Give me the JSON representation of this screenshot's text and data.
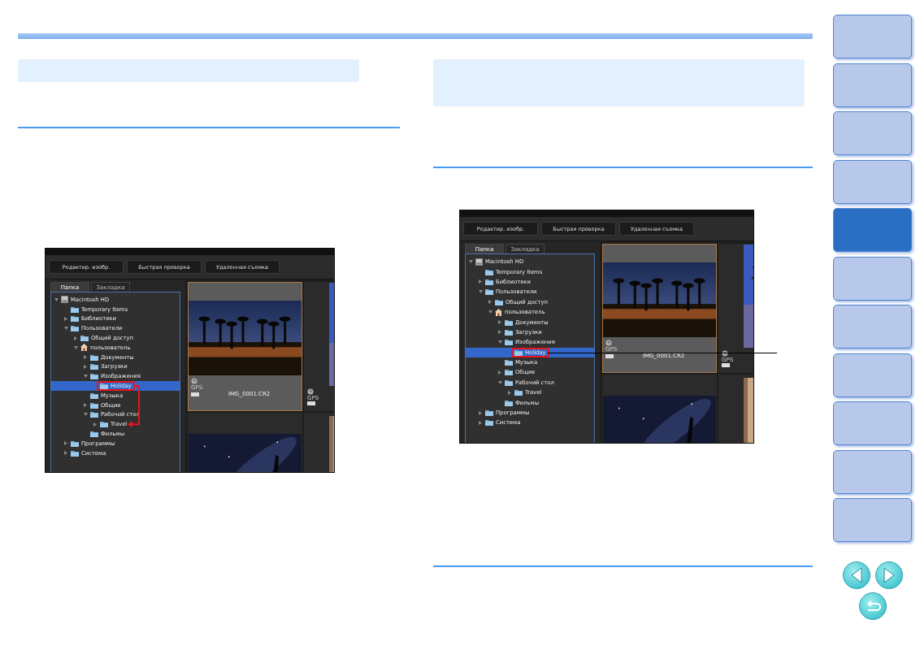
{
  "chapter_nav": [
    {
      "selected": false
    },
    {
      "selected": false
    },
    {
      "selected": false
    },
    {
      "selected": false
    },
    {
      "selected": true
    },
    {
      "selected": false
    },
    {
      "selected": false
    },
    {
      "selected": false
    },
    {
      "selected": false
    },
    {
      "selected": false
    },
    {
      "selected": false
    }
  ],
  "pager": [
    {
      "kind": "prev"
    },
    {
      "kind": "next"
    },
    {
      "kind": "return"
    }
  ],
  "screens": [
    {
      "kind": "arrow",
      "toolbar": [
        "Редактир. изобр.",
        "Быстрая проверка",
        "Удаленная съемка"
      ],
      "tabs": [
        {
          "label": "Папка",
          "selected": true
        },
        {
          "label": "Закладка",
          "selected": false
        }
      ],
      "tree": [
        {
          "label": "Macintosh HD",
          "kind": "disk",
          "expandable": true,
          "expanded": true,
          "selected": false,
          "children": [
            {
              "label": "Temporary Items",
              "kind": "folder",
              "expandable": false,
              "selected": false
            },
            {
              "label": "Библиотеки",
              "kind": "folder",
              "expandable": true,
              "expanded": false,
              "selected": false
            },
            {
              "label": "Пользователи",
              "kind": "folder",
              "expandable": true,
              "expanded": true,
              "selected": false,
              "children": [
                {
                  "label": "Общий доступ",
                  "kind": "folder",
                  "expandable": true,
                  "expanded": false,
                  "selected": false
                },
                {
                  "label": "пользователь",
                  "kind": "home",
                  "expandable": true,
                  "expanded": true,
                  "selected": false,
                  "children": [
                    {
                      "label": "Документы",
                      "kind": "folder",
                      "expandable": true,
                      "expanded": false,
                      "selected": false
                    },
                    {
                      "label": "Загрузки",
                      "kind": "folder",
                      "expandable": true,
                      "expanded": false,
                      "selected": false
                    },
                    {
                      "label": "Изображения",
                      "kind": "folder",
                      "expandable": true,
                      "expanded": true,
                      "selected": false,
                      "children": [
                        {
                          "label": "Holiday",
                          "kind": "folder",
                          "expandable": false,
                          "selected": true
                        }
                      ]
                    },
                    {
                      "label": "Музыка",
                      "kind": "folder",
                      "expandable": false,
                      "selected": false
                    },
                    {
                      "label": "Общие",
                      "kind": "folder",
                      "expandable": true,
                      "expanded": false,
                      "selected": false
                    },
                    {
                      "label": "Рабочий стол",
                      "kind": "folder",
                      "expandable": true,
                      "expanded": true,
                      "selected": false,
                      "children": [
                        {
                          "label": "Travel",
                          "kind": "folder",
                          "expandable": true,
                          "expanded": false,
                          "selected": false
                        }
                      ]
                    },
                    {
                      "label": "Фильмы",
                      "kind": "folder",
                      "expandable": false,
                      "selected": false
                    }
                  ]
                }
              ]
            },
            {
              "label": "Программы",
              "kind": "folder",
              "expandable": true,
              "expanded": false,
              "selected": false
            },
            {
              "label": "Система",
              "kind": "folder",
              "expandable": true,
              "expanded": false,
              "selected": false
            }
          ]
        }
      ],
      "thumbnails": [
        {
          "selected": true,
          "gps": "GPS",
          "filename": "IMG_0001.CR2"
        },
        {
          "selected": false,
          "gps": "GPS"
        },
        {
          "selected": false
        },
        {
          "selected": false
        }
      ]
    },
    {
      "kind": "leader",
      "toolbar": [
        "Редактир. изобр.",
        "Быстрая проверка",
        "Удаленная съемка"
      ],
      "tabs": [
        {
          "label": "Папка",
          "selected": true
        },
        {
          "label": "Закладка",
          "selected": false
        }
      ],
      "tree": [
        {
          "label": "Macintosh HD",
          "kind": "disk",
          "expandable": true,
          "expanded": true,
          "selected": false,
          "children": [
            {
              "label": "Temporary Items",
              "kind": "folder",
              "expandable": false,
              "selected": false
            },
            {
              "label": "Библиотеки",
              "kind": "folder",
              "expandable": true,
              "expanded": false,
              "selected": false
            },
            {
              "label": "Пользователи",
              "kind": "folder",
              "expandable": true,
              "expanded": true,
              "selected": false,
              "children": [
                {
                  "label": "Общий доступ",
                  "kind": "folder",
                  "expandable": true,
                  "expanded": false,
                  "selected": false
                },
                {
                  "label": "пользователь",
                  "kind": "home",
                  "expandable": true,
                  "expanded": true,
                  "selected": false,
                  "children": [
                    {
                      "label": "Документы",
                      "kind": "folder",
                      "expandable": true,
                      "expanded": false,
                      "selected": false
                    },
                    {
                      "label": "Загрузки",
                      "kind": "folder",
                      "expandable": true,
                      "expanded": false,
                      "selected": false
                    },
                    {
                      "label": "Изображения",
                      "kind": "folder",
                      "expandable": true,
                      "expanded": true,
                      "selected": false,
                      "children": [
                        {
                          "label": "Holiday",
                          "kind": "folder",
                          "expandable": false,
                          "selected": true
                        }
                      ]
                    },
                    {
                      "label": "Музыка",
                      "kind": "folder",
                      "expandable": false,
                      "selected": false
                    },
                    {
                      "label": "Общие",
                      "kind": "folder",
                      "expandable": true,
                      "expanded": false,
                      "selected": false
                    },
                    {
                      "label": "Рабочий стол",
                      "kind": "folder",
                      "expandable": true,
                      "expanded": true,
                      "selected": false,
                      "children": [
                        {
                          "label": "Travel",
                          "kind": "folder",
                          "expandable": true,
                          "expanded": false,
                          "selected": false
                        }
                      ]
                    },
                    {
                      "label": "Фильмы",
                      "kind": "folder",
                      "expandable": false,
                      "selected": false
                    }
                  ]
                }
              ]
            },
            {
              "label": "Программы",
              "kind": "folder",
              "expandable": true,
              "expanded": false,
              "selected": false
            },
            {
              "label": "Система",
              "kind": "folder",
              "expandable": true,
              "expanded": false,
              "selected": false
            }
          ]
        }
      ],
      "thumbnails": [
        {
          "selected": true,
          "gps": "GPS",
          "filename": "IMG_0001.CR2"
        },
        {
          "selected": false,
          "gps": "GPS"
        },
        {
          "selected": false
        },
        {
          "selected": false
        }
      ]
    }
  ]
}
